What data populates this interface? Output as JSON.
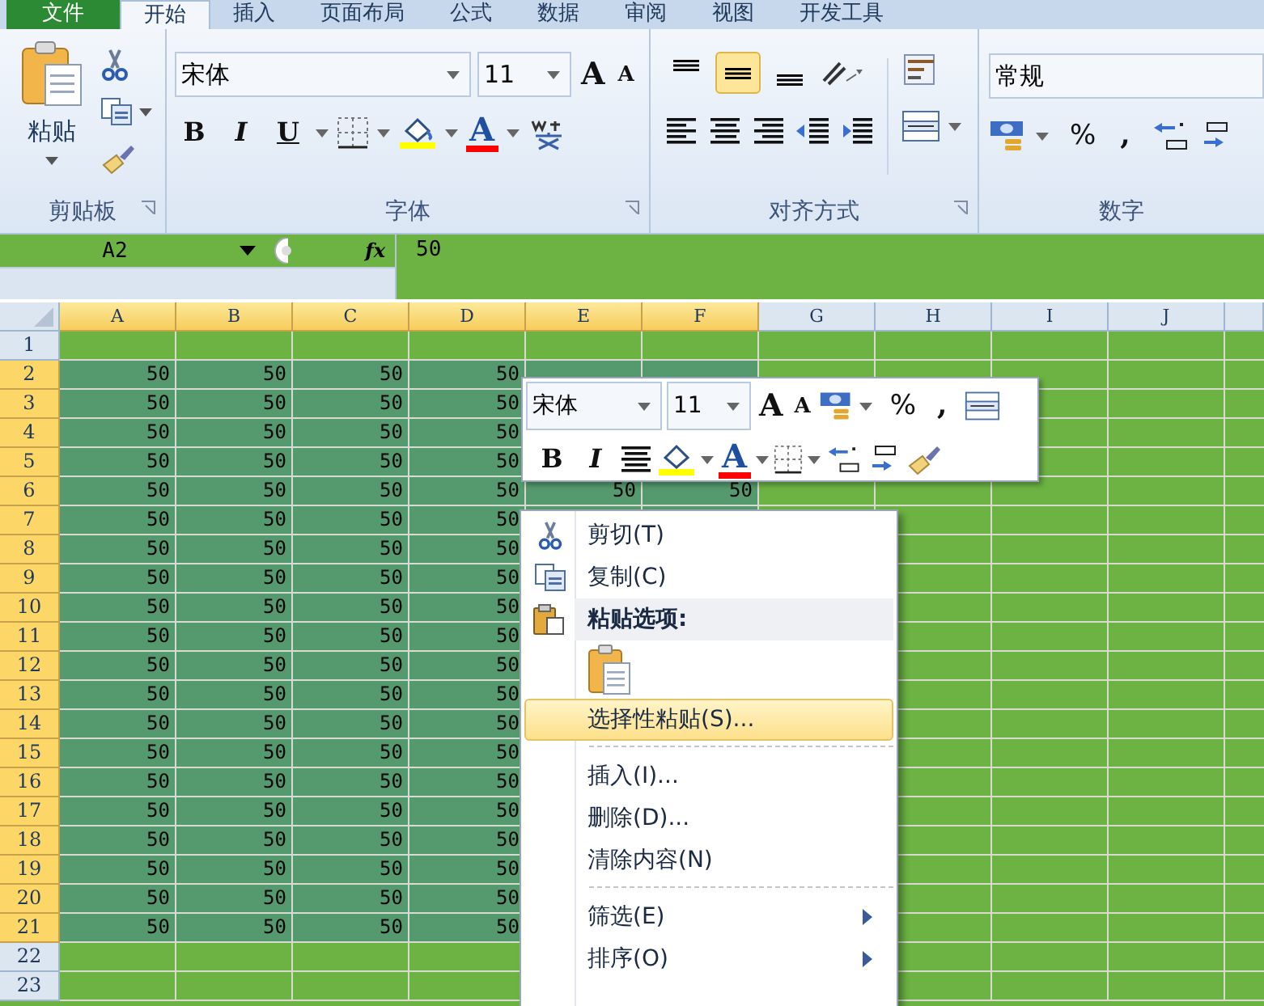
{
  "tabs": [
    {
      "label": "文件",
      "kind": "file",
      "selected": false
    },
    {
      "label": "开始",
      "kind": "tab",
      "selected": true
    },
    {
      "label": "插入",
      "kind": "tab",
      "selected": false
    },
    {
      "label": "页面布局",
      "kind": "tab",
      "selected": false
    },
    {
      "label": "公式",
      "kind": "tab",
      "selected": false
    },
    {
      "label": "数据",
      "kind": "tab",
      "selected": false
    },
    {
      "label": "审阅",
      "kind": "tab",
      "selected": false
    },
    {
      "label": "视图",
      "kind": "tab",
      "selected": false
    },
    {
      "label": "开发工具",
      "kind": "tab",
      "selected": false
    }
  ],
  "ribbon": {
    "clipboard": {
      "paste_label": "粘贴",
      "group_label": "剪贴板"
    },
    "font": {
      "font_name": "宋体",
      "font_size": "11",
      "grow": "A",
      "shrink": "A",
      "style_buttons": [
        "B",
        "I",
        "U"
      ],
      "font_color": "A",
      "group_label": "字体"
    },
    "alignment": {
      "vertical": [
        {
          "selected": false
        },
        {
          "selected": true
        },
        {
          "selected": false
        }
      ],
      "group_label": "对齐方式"
    },
    "number": {
      "format": "常规",
      "percent": "%",
      "comma": ",",
      "group_label": "数字"
    }
  },
  "formula_bar": {
    "name_box": "A2",
    "function_label": "fx",
    "value": "50"
  },
  "columns": [
    {
      "label": "A",
      "selected": true
    },
    {
      "label": "B",
      "selected": true
    },
    {
      "label": "C",
      "selected": true
    },
    {
      "label": "D",
      "selected": true
    },
    {
      "label": "E",
      "selected": true
    },
    {
      "label": "F",
      "selected": true
    },
    {
      "label": "G",
      "selected": false
    },
    {
      "label": "H",
      "selected": false
    },
    {
      "label": "I",
      "selected": false
    },
    {
      "label": "J",
      "selected": false
    }
  ],
  "rows": [
    {
      "label": "1",
      "selected": false,
      "cells": []
    },
    {
      "label": "2",
      "selected": true,
      "cells": [
        "50",
        "50",
        "50",
        "50"
      ]
    },
    {
      "label": "3",
      "selected": true,
      "cells": [
        "50",
        "50",
        "50",
        "50"
      ]
    },
    {
      "label": "4",
      "selected": true,
      "cells": [
        "50",
        "50",
        "50",
        "50"
      ]
    },
    {
      "label": "5",
      "selected": true,
      "cells": [
        "50",
        "50",
        "50",
        "50"
      ]
    },
    {
      "label": "6",
      "selected": true,
      "cells": [
        "50",
        "50",
        "50",
        "50",
        "50",
        "50"
      ]
    },
    {
      "label": "7",
      "selected": true,
      "cells": [
        "50",
        "50",
        "50",
        "50"
      ]
    },
    {
      "label": "8",
      "selected": true,
      "cells": [
        "50",
        "50",
        "50",
        "50"
      ]
    },
    {
      "label": "9",
      "selected": true,
      "cells": [
        "50",
        "50",
        "50",
        "50"
      ]
    },
    {
      "label": "10",
      "selected": true,
      "cells": [
        "50",
        "50",
        "50",
        "50"
      ]
    },
    {
      "label": "11",
      "selected": true,
      "cells": [
        "50",
        "50",
        "50",
        "50"
      ]
    },
    {
      "label": "12",
      "selected": true,
      "cells": [
        "50",
        "50",
        "50",
        "50"
      ]
    },
    {
      "label": "13",
      "selected": true,
      "cells": [
        "50",
        "50",
        "50",
        "50"
      ]
    },
    {
      "label": "14",
      "selected": true,
      "cells": [
        "50",
        "50",
        "50",
        "50"
      ]
    },
    {
      "label": "15",
      "selected": true,
      "cells": [
        "50",
        "50",
        "50",
        "50"
      ]
    },
    {
      "label": "16",
      "selected": true,
      "cells": [
        "50",
        "50",
        "50",
        "50"
      ]
    },
    {
      "label": "17",
      "selected": true,
      "cells": [
        "50",
        "50",
        "50",
        "50"
      ]
    },
    {
      "label": "18",
      "selected": true,
      "cells": [
        "50",
        "50",
        "50",
        "50"
      ]
    },
    {
      "label": "19",
      "selected": true,
      "cells": [
        "50",
        "50",
        "50",
        "50"
      ]
    },
    {
      "label": "20",
      "selected": true,
      "cells": [
        "50",
        "50",
        "50",
        "50"
      ]
    },
    {
      "label": "21",
      "selected": true,
      "cells": [
        "50",
        "50",
        "50",
        "50"
      ]
    },
    {
      "label": "22",
      "selected": false,
      "cells": []
    },
    {
      "label": "23",
      "selected": false,
      "cells": []
    }
  ],
  "mini_toolbar": {
    "font_name": "宋体",
    "font_size": "11",
    "grow": "A",
    "shrink": "A",
    "percent": "%",
    "comma": ",",
    "bold": "B",
    "italic": "I",
    "font_color": "A"
  },
  "context_menu": {
    "items": [
      {
        "kind": "cut",
        "label": "剪切(T)",
        "selected": false
      },
      {
        "kind": "copy",
        "label": "复制(C)",
        "selected": false
      },
      {
        "kind": "paste-header",
        "label": "粘贴选项:"
      },
      {
        "kind": "paste-options"
      },
      {
        "kind": "item",
        "label": "选择性粘贴(S)...",
        "selected": true
      },
      {
        "kind": "separator"
      },
      {
        "kind": "item",
        "label": "插入(I)...",
        "selected": false
      },
      {
        "kind": "item",
        "label": "删除(D)...",
        "selected": false
      },
      {
        "kind": "item",
        "label": "清除内容(N)",
        "selected": false
      },
      {
        "kind": "separator"
      },
      {
        "kind": "submenu",
        "label": "筛选(E)",
        "selected": false
      },
      {
        "kind": "submenu",
        "label": "排序(O)",
        "selected": false
      }
    ]
  }
}
